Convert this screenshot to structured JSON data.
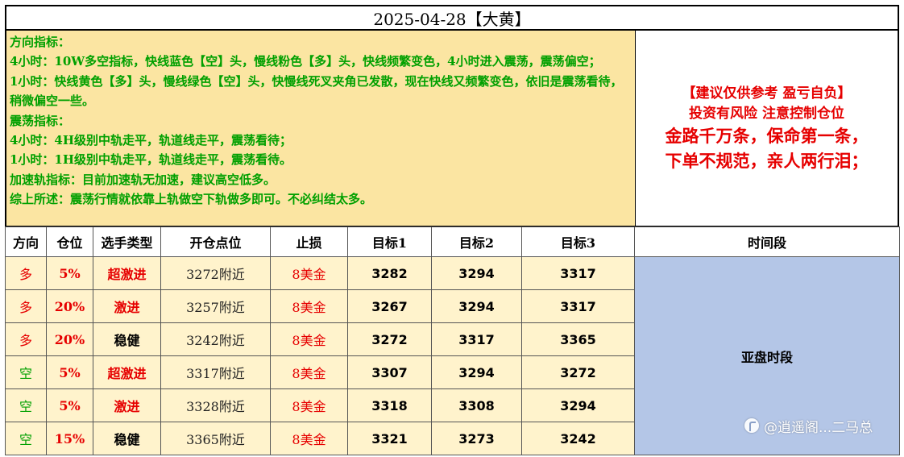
{
  "title": "2025-04-28【大黄】",
  "analysis_lines": [
    "方向指标：",
    "4小时：10W多空指标，快线蓝色【空】头，慢线粉色【多】头，快线频繁变色，4小时进入震荡，震荡偏空；",
    "1小时：快线黄色【多】头，慢线绿色【空】头，快慢线死叉夹角已发散，现在快线又频繁变色，依旧是震荡看待，稍微偏空一些。",
    "震荡指标：",
    "4小时：4H级别中轨走平，轨道线走平，震荡看待；",
    "1小时：1H级别中轨走平，轨道线走平，震荡看待。",
    "加速轨指标：目前加速轨无加速，建议高空低多。",
    "综上所述：震荡行情就依靠上轨做空下轨做多即可。不必纠结太多。"
  ],
  "disclaimer": {
    "line1": "【建议仅供参考 盈亏自负】",
    "line2": "投资有风险 注意控制仓位",
    "line3": "金路千万条，保命第一条，",
    "line4": "下单不规范，亲人两行泪；"
  },
  "table": {
    "headers": [
      "方向",
      "仓位",
      "选手类型",
      "开仓点位",
      "止损",
      "目标1",
      "目标2",
      "目标3",
      "时间段"
    ],
    "rows": [
      {
        "direction": "多",
        "position": "5%",
        "type": "超激进",
        "entry": "3272附近",
        "stop": "8美金",
        "t1": "3282",
        "t2": "3294",
        "t3": "3317"
      },
      {
        "direction": "多",
        "position": "20%",
        "type": "激进",
        "entry": "3257附近",
        "stop": "8美金",
        "t1": "3267",
        "t2": "3294",
        "t3": "3317"
      },
      {
        "direction": "多",
        "position": "20%",
        "type": "稳健",
        "entry": "3242附近",
        "stop": "8美金",
        "t1": "3272",
        "t2": "3317",
        "t3": "3365"
      },
      {
        "direction": "空",
        "position": "5%",
        "type": "超激进",
        "entry": "3317附近",
        "stop": "8美金",
        "t1": "3307",
        "t2": "3294",
        "t3": "3272"
      },
      {
        "direction": "空",
        "position": "5%",
        "type": "激进",
        "entry": "3328附近",
        "stop": "8美金",
        "t1": "3318",
        "t2": "3308",
        "t3": "3294"
      },
      {
        "direction": "空",
        "position": "15%",
        "type": "稳健",
        "entry": "3365附近",
        "stop": "8美金",
        "t1": "3321",
        "t2": "3273",
        "t3": "3242"
      }
    ],
    "session": "亚盘时段"
  },
  "watermark": "@逍遥阁...二马总",
  "colors": {
    "analysis_bg": "#fbe5a2",
    "analysis_text": "#00a000",
    "row_bg": "#fff3cc",
    "session_bg": "#b4c6e7",
    "red": "#e60000"
  }
}
